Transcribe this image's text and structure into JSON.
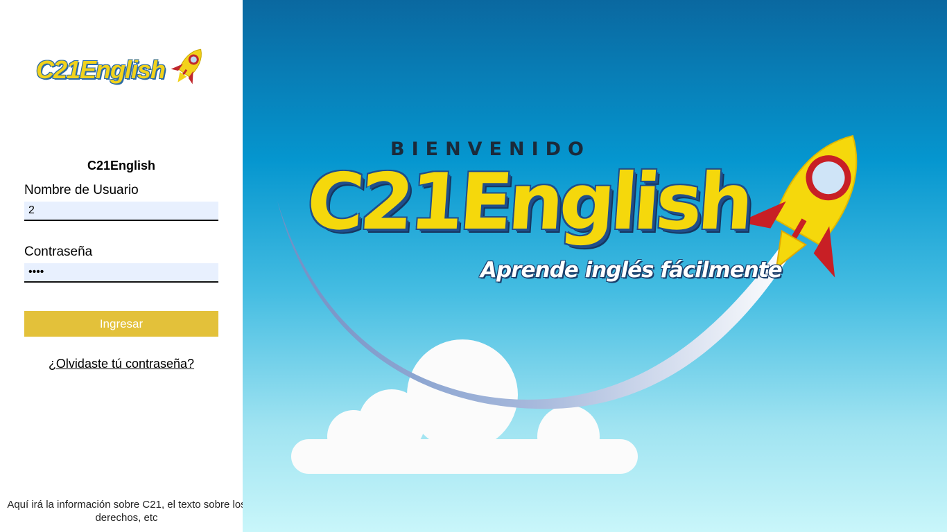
{
  "brand": {
    "logo_text": "C21English",
    "logo_icon": "rocket-icon"
  },
  "login": {
    "title": "C21English",
    "username_label": "Nombre de Usuario",
    "username_value": "2",
    "password_label": "Contraseña",
    "password_value": "1234",
    "submit_label": "Ingresar",
    "forgot_label": "¿Olvidaste tú contraseña?"
  },
  "footer": {
    "text": "Aquí irá la información sobre C21, el texto sobre los derechos, etc"
  },
  "hero": {
    "welcome": "BIENVENIDO",
    "brand": "C21English",
    "tagline": "Aprende inglés fácilmente"
  },
  "colors": {
    "accent_yellow": "#e3c13a",
    "input_bg": "#e8f0fe",
    "hero_top": "#0a68a0",
    "hero_bottom": "#c9f6fa"
  }
}
